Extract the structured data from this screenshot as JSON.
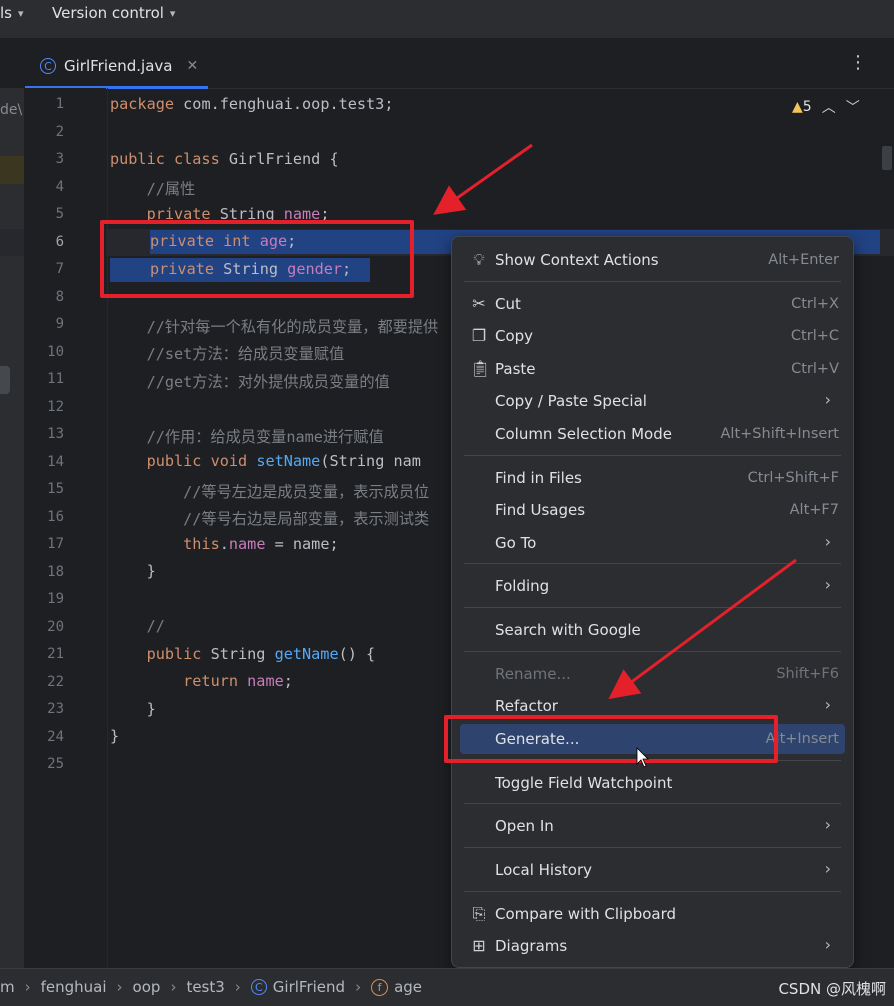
{
  "topbar": {
    "left_item": "ls",
    "vcs_label": "Version control"
  },
  "tab": {
    "filename": "GirlFriend.java",
    "icon_letter": "C"
  },
  "warnings": {
    "count": "5"
  },
  "left_panel": {
    "fragment": "de\\"
  },
  "line_numbers": [
    "1",
    "2",
    "3",
    "4",
    "5",
    "6",
    "7",
    "8",
    "9",
    "10",
    "11",
    "12",
    "13",
    "14",
    "15",
    "16",
    "17",
    "18",
    "19",
    "20",
    "21",
    "22",
    "23",
    "24",
    "25"
  ],
  "code": {
    "l1a": "package",
    "l1b": " com.fenghuai.oop.test3;",
    "l3a": "public class",
    "l3b": " GirlFriend {",
    "l4": "    //属性",
    "l5a": "    private",
    "l5b": " String ",
    "l5c": "name",
    "l5d": ";",
    "l6a": "private int ",
    "l6b": "age",
    "l6c": ";",
    "l7a": "private",
    "l7b": " String ",
    "l7c": "gender",
    "l7d": ";",
    "l9": "    //针对每一个私有化的成员变量，都要提供",
    "l10": "    //set方法：给成员变量赋值",
    "l11": "    //get方法：对外提供成员变量的值",
    "l13": "    //作用：给成员变量name进行赋值",
    "l14a": "    public void ",
    "l14b": "setName",
    "l14c": "(String nam",
    "l15": "        //等号左边是成员变量，表示成员位",
    "l16": "        //等号右边是局部变量，表示测试类",
    "l17a": "        this",
    "l17b": ".",
    "l17c": "name",
    "l17d": " = name;",
    "l18": "    }",
    "l20": "    //",
    "l21a": "    public",
    "l21b": " String ",
    "l21c": "getName",
    "l21d": "() {",
    "l22a": "        return ",
    "l22b": "name",
    "l22c": ";",
    "l23": "    }",
    "l24": "}"
  },
  "menu": {
    "items": [
      {
        "label": "Show Context Actions",
        "shortcut": "Alt+Enter",
        "icon": "lightbulb-icon"
      },
      {
        "label": "Cut",
        "shortcut": "Ctrl+X",
        "icon": "scissors-icon"
      },
      {
        "label": "Copy",
        "shortcut": "Ctrl+C",
        "icon": "copy-icon"
      },
      {
        "label": "Paste",
        "shortcut": "Ctrl+V",
        "icon": "clipboard-icon"
      },
      {
        "label": "Copy / Paste Special",
        "shortcut": "",
        "icon": ""
      },
      {
        "label": "Column Selection Mode",
        "shortcut": "Alt+Shift+Insert",
        "icon": ""
      },
      {
        "label": "Find in Files",
        "shortcut": "Ctrl+Shift+F",
        "icon": ""
      },
      {
        "label": "Find Usages",
        "shortcut": "Alt+F7",
        "icon": ""
      },
      {
        "label": "Go To",
        "shortcut": "",
        "icon": ""
      },
      {
        "label": "Folding",
        "shortcut": "",
        "icon": ""
      },
      {
        "label": "Search with Google",
        "shortcut": "",
        "icon": ""
      },
      {
        "label": "Rename...",
        "shortcut": "Shift+F6",
        "icon": ""
      },
      {
        "label": "Refactor",
        "shortcut": "",
        "icon": ""
      },
      {
        "label": "Generate...",
        "shortcut": "Alt+Insert",
        "icon": ""
      },
      {
        "label": "Toggle Field Watchpoint",
        "shortcut": "",
        "icon": ""
      },
      {
        "label": "Open In",
        "shortcut": "",
        "icon": ""
      },
      {
        "label": "Local History",
        "shortcut": "",
        "icon": ""
      },
      {
        "label": "Compare with Clipboard",
        "shortcut": "",
        "icon": "compare-clipboard-icon"
      },
      {
        "label": "Diagrams",
        "shortcut": "",
        "icon": "diagram-icon"
      }
    ]
  },
  "breadcrumb": {
    "items": [
      "m",
      "fenghuai",
      "oop",
      "test3",
      "GirlFriend",
      "age"
    ],
    "class_icon": "C",
    "field_icon": "f"
  },
  "watermark": "CSDN @风槐啊",
  "colors": {
    "accent": "#3574f0",
    "selection": "#214283",
    "highlight_box": "#e4202b",
    "menu_highlight": "#2e436e"
  }
}
